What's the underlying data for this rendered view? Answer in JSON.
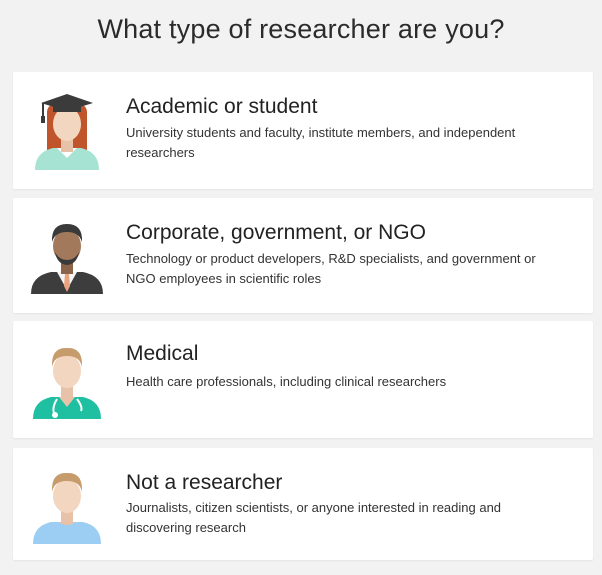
{
  "page": {
    "title": "What type of researcher are you?"
  },
  "options": [
    {
      "title": "Academic or student",
      "description": "University students and faculty, institute members, and independent researchers",
      "icon": "academic-avatar-icon"
    },
    {
      "title": "Corporate, government, or NGO",
      "description": "Technology or product developers, R&D specialists, and government or NGO employees in scientific roles",
      "icon": "corporate-avatar-icon"
    },
    {
      "title": "Medical",
      "description": "Health care professionals, including clinical researchers",
      "icon": "medical-avatar-icon"
    },
    {
      "title": "Not a researcher",
      "description": "Journalists, citizen scientists, or anyone interested in reading and discovering research",
      "icon": "non-researcher-avatar-icon"
    }
  ],
  "colors": {
    "background": "#f2f2f2",
    "card": "#ffffff",
    "skin": "#f3d6c0",
    "academic_hair": "#c0542a",
    "academic_shirt": "#a6e3d3",
    "cap": "#3b3b3b",
    "corporate_skin": "#a3795c",
    "corporate_hair": "#3a3a3a",
    "suit": "#3d3d3d",
    "tie": "#e9a37e",
    "blond_hair": "#c69c6d",
    "scrubs": "#1fbfa2",
    "casual_shirt": "#9ccdf2"
  }
}
